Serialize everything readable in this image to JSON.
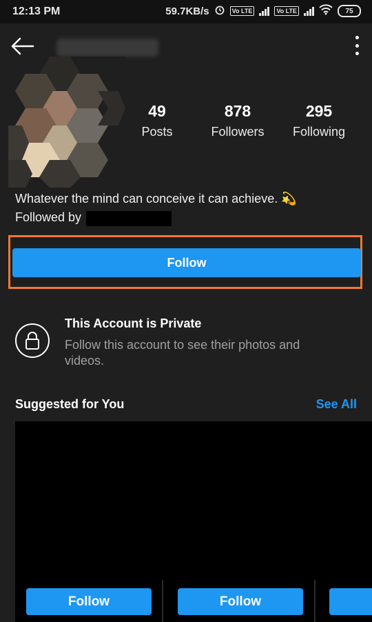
{
  "status_bar": {
    "time": "12:13 PM",
    "speed": "59.7KB/s",
    "sim1_badge": "Vo LTE",
    "sim2_badge": "Vo LTE",
    "battery": "75",
    "icons": [
      "alarm-icon",
      "signal-icon",
      "wifi-icon",
      "battery-icon"
    ]
  },
  "header": {
    "back_icon": "arrow-left-icon",
    "menu_icon": "more-vertical-icon"
  },
  "profile": {
    "stats": [
      {
        "value": "49",
        "label": "Posts"
      },
      {
        "value": "878",
        "label": "Followers"
      },
      {
        "value": "295",
        "label": "Following"
      }
    ],
    "bio": "Whatever the mind can conceive it can achieve. 💫",
    "followed_by": "Followed by"
  },
  "actions": {
    "follow_label": "Follow"
  },
  "private": {
    "title": "This Account is Private",
    "text": "Follow this account to see their photos and videos."
  },
  "suggested": {
    "title": "Suggested for You",
    "see_all": "See All",
    "cards": [
      {
        "follow_label": "Follow"
      },
      {
        "follow_label": "Follow"
      }
    ]
  },
  "colors": {
    "accent": "#1d97f1",
    "highlight": "#ef7a2d",
    "background": "#1f1f1f"
  }
}
